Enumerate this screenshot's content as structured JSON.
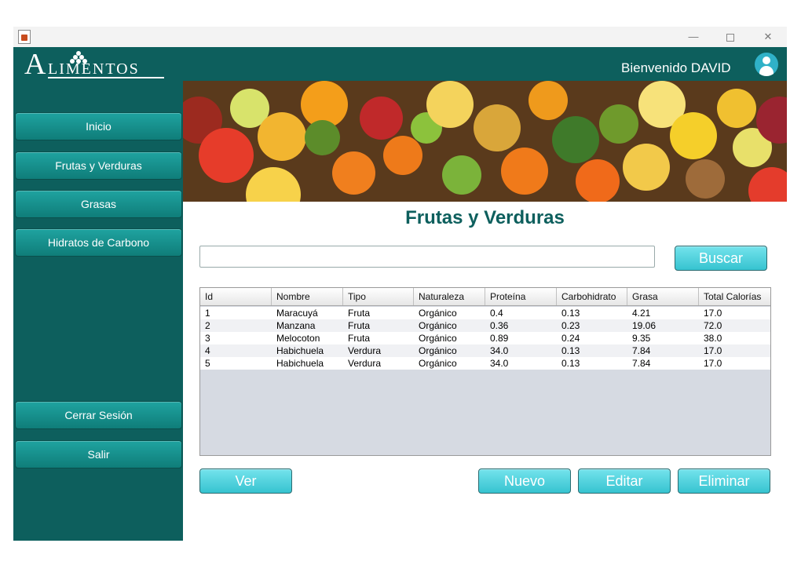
{
  "window": {
    "controls": {
      "minimize": "—",
      "close": "✕"
    }
  },
  "header": {
    "logo_initial": "A",
    "logo_rest": "LIMENTOS",
    "welcome": "Bienvenido DAVID",
    "avatar_icon": "user-icon"
  },
  "sidebar": {
    "items": [
      {
        "label": "Inicio"
      },
      {
        "label": "Frutas y Verduras"
      },
      {
        "label": "Grasas"
      },
      {
        "label": "Hidratos de Carbono"
      }
    ],
    "bottom_items": [
      {
        "label": "Cerrar Sesión"
      },
      {
        "label": "Salir"
      }
    ]
  },
  "main": {
    "title": "Frutas y Verduras",
    "search": {
      "value": "",
      "button": "Buscar"
    },
    "table": {
      "columns": [
        "Id",
        "Nombre",
        "Tipo",
        "Naturaleza",
        "Proteína",
        "Carbohidrato",
        "Grasa",
        "Total Calorías"
      ],
      "rows": [
        [
          "1",
          "Maracuyá",
          "Fruta",
          "Orgánico",
          "0.4",
          "0.13",
          "4.21",
          "17.0"
        ],
        [
          "2",
          "Manzana",
          "Fruta",
          "Orgánico",
          "0.36",
          "0.23",
          "19.06",
          "72.0"
        ],
        [
          "3",
          "Melocoton",
          "Fruta",
          "Orgánico",
          "0.89",
          "0.24",
          "9.35",
          "38.0"
        ],
        [
          "4",
          "Habichuela",
          "Verdura",
          "Orgánico",
          "34.0",
          "0.13",
          "7.84",
          "17.0"
        ],
        [
          "5",
          "Habichuela",
          "Verdura",
          "Orgánico",
          "34.0",
          "0.13",
          "7.84",
          "17.0"
        ]
      ]
    },
    "actions": {
      "view": "Ver",
      "new": "Nuevo",
      "edit": "Editar",
      "delete": "Eliminar"
    }
  },
  "colors": {
    "primary": "#0d5f5d",
    "button": "#36c3d0",
    "title": "#0d5f5d"
  }
}
